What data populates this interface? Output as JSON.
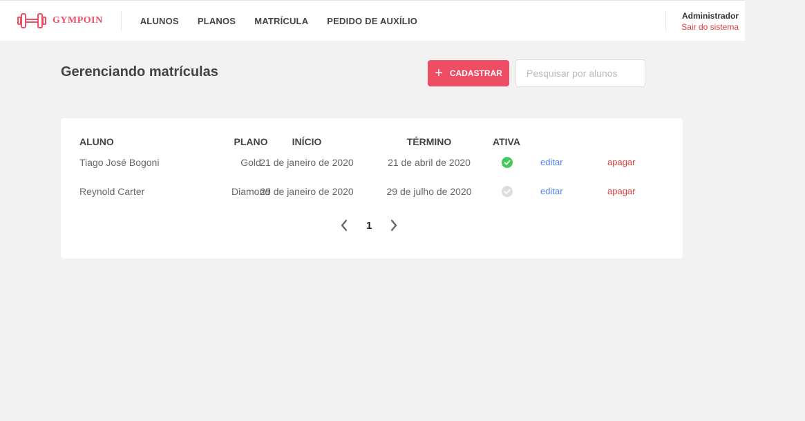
{
  "header": {
    "logo_text": "GYMPOIN",
    "nav": [
      "ALUNOS",
      "PLANOS",
      "MATRÍCULA",
      "PEDIDO DE AUXÍLIO"
    ],
    "user_name": "Administrador",
    "logout": "Sair do sistema"
  },
  "page": {
    "title": "Gerenciando matrículas",
    "add_button": "CADASTRAR",
    "search_placeholder": "Pesquisar por alunos"
  },
  "table": {
    "columns": [
      "ALUNO",
      "PLANO",
      "INÍCIO",
      "TÉRMINO",
      "ATIVA"
    ],
    "rows": [
      {
        "aluno": "Tiago José Bogoni",
        "plano": "Gold",
        "inicio": "21 de janeiro de 2020",
        "termino": "21 de abril de 2020",
        "ativa": true,
        "edit": "editar",
        "delete": "apagar"
      },
      {
        "aluno": "Reynold Carter",
        "plano": "Diamond",
        "inicio": "29 de janeiro de 2020",
        "termino": "29 de julho de 2020",
        "ativa": false,
        "edit": "editar",
        "delete": "apagar"
      }
    ]
  },
  "pagination": {
    "current_page": "1"
  },
  "colors": {
    "accent": "#ee4d64",
    "active": "#42cb59",
    "inactive": "#dddddd",
    "edit_link": "#4d85ee",
    "delete_link": "#de3b3b"
  }
}
